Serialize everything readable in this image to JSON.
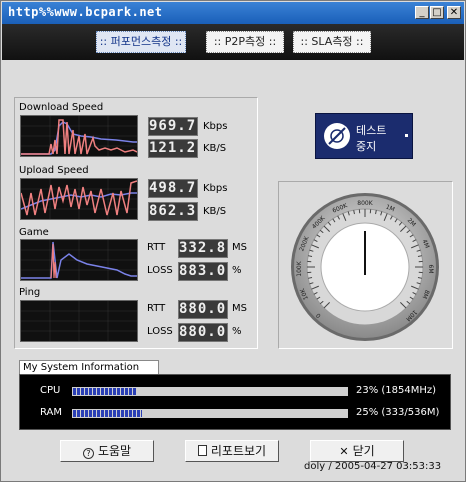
{
  "window": {
    "title": "http%%www.bcpark.net",
    "minimize": "_",
    "maximize": "□",
    "close": "✕"
  },
  "tabs": [
    {
      "label": ":: 퍼포먼스측정 ::",
      "active": true
    },
    {
      "label": ":: P2P측정 ::",
      "active": false
    },
    {
      "label": ":: SLA측정 ::",
      "active": false
    }
  ],
  "download": {
    "label": "Download Speed",
    "kbps": "969.7",
    "kbps_unit": "Kbps",
    "kbs": "121.2",
    "kbs_unit": "KB/S"
  },
  "upload": {
    "label": "Upload Speed",
    "kbps": "498.7",
    "kbps_unit": "Kbps",
    "kbs": "862.3",
    "kbs_unit": "KB/S"
  },
  "game": {
    "label": "Game",
    "rtt_label": "RTT",
    "rtt": "332.8",
    "rtt_unit": "MS",
    "loss_label": "LOSS",
    "loss": "883.0",
    "loss_unit": "%"
  },
  "ping": {
    "label": "Ping",
    "rtt_label": "RTT",
    "rtt": "880.0",
    "rtt_unit": "MS",
    "loss_label": "LOSS",
    "loss": "880.0",
    "loss_unit": "%"
  },
  "stop_button": {
    "line1": "테스트",
    "line2": "중지"
  },
  "gauge": {
    "ticks": [
      "0",
      "10K",
      "100K",
      "200K",
      "400K",
      "600K",
      "800K",
      "1M",
      "2M",
      "4M",
      "6M",
      "8M",
      "10M"
    ]
  },
  "system": {
    "title": "My System Information",
    "cpu_label": "CPU",
    "cpu_value": "23% (1854MHz)",
    "cpu_fraction": 0.23,
    "ram_label": "RAM",
    "ram_value": "25% (333/536M)",
    "ram_fraction": 0.25
  },
  "buttons": {
    "help": "도움말",
    "report": "리포트보기",
    "close": "닫기"
  },
  "footer": "doly / 2005-04-27 03:53:33",
  "colors": {
    "accent": "#1b2c6e",
    "bar": "#2a3fb5",
    "graph_line": "#f08080"
  }
}
